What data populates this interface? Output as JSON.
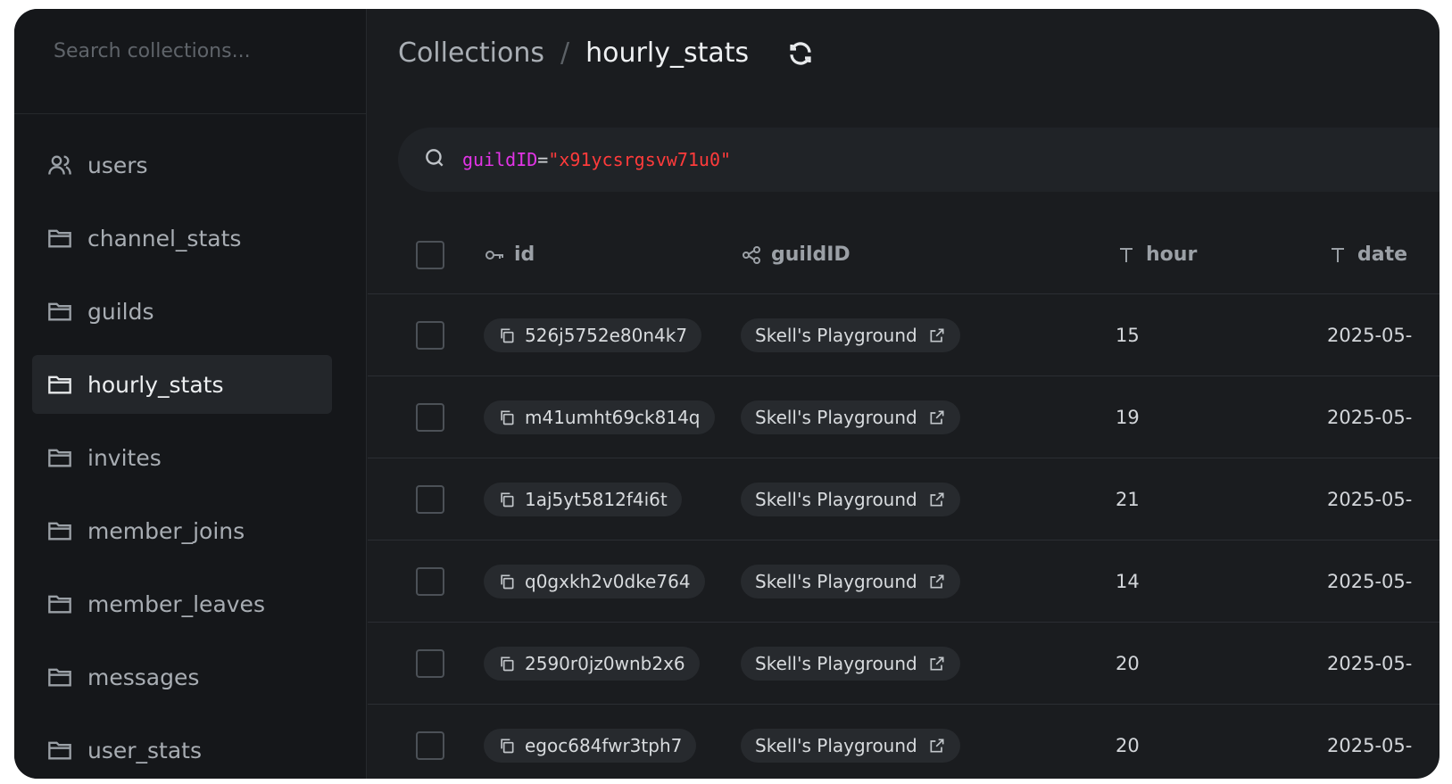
{
  "sidebar": {
    "search_placeholder": "Search collections...",
    "items": [
      {
        "label": "users",
        "icon": "users-icon"
      },
      {
        "label": "channel_stats",
        "icon": "folder-icon"
      },
      {
        "label": "guilds",
        "icon": "folder-icon"
      },
      {
        "label": "hourly_stats",
        "icon": "folder-icon",
        "active": true
      },
      {
        "label": "invites",
        "icon": "folder-icon"
      },
      {
        "label": "member_joins",
        "icon": "folder-icon"
      },
      {
        "label": "member_leaves",
        "icon": "folder-icon"
      },
      {
        "label": "messages",
        "icon": "folder-icon"
      },
      {
        "label": "user_stats",
        "icon": "folder-icon"
      }
    ]
  },
  "header": {
    "breadcrumb_root": "Collections",
    "breadcrumb_sep": "/",
    "breadcrumb_current": "hourly_stats"
  },
  "filter": {
    "key": "guildID",
    "op": "=",
    "value": "\"x91ycsrgsvw71u0\""
  },
  "table": {
    "columns": [
      {
        "label": "id",
        "icon": "key-icon"
      },
      {
        "label": "guildID",
        "icon": "relation-icon"
      },
      {
        "label": "hour",
        "icon": "text-type-icon"
      },
      {
        "label": "date",
        "icon": "text-type-icon"
      }
    ],
    "rows": [
      {
        "id": "526j5752e80n4k7",
        "guild": "Skell's Playground",
        "hour": "15",
        "date": "2025-05-"
      },
      {
        "id": "m41umht69ck814q",
        "guild": "Skell's Playground",
        "hour": "19",
        "date": "2025-05-"
      },
      {
        "id": "1aj5yt5812f4i6t",
        "guild": "Skell's Playground",
        "hour": "21",
        "date": "2025-05-"
      },
      {
        "id": "q0gxkh2v0dke764",
        "guild": "Skell's Playground",
        "hour": "14",
        "date": "2025-05-"
      },
      {
        "id": "2590r0jz0wnb2x6",
        "guild": "Skell's Playground",
        "hour": "20",
        "date": "2025-05-"
      },
      {
        "id": "egoc684fwr3tph7",
        "guild": "Skell's Playground",
        "hour": "20",
        "date": "2025-05-"
      }
    ]
  },
  "colors": {
    "background": "#1a1c1f",
    "sidebar": "#15171a",
    "filter_key": "#e234e6",
    "filter_value": "#ff3b3b"
  }
}
